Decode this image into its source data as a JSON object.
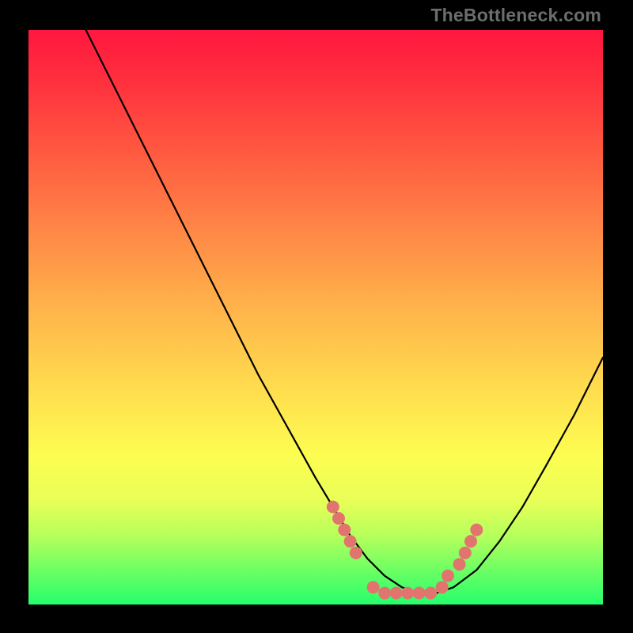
{
  "watermark": "TheBottleneck.com",
  "chart_data": {
    "type": "line",
    "title": "",
    "xlabel": "",
    "ylabel": "",
    "xlim": [
      0,
      100
    ],
    "ylim": [
      0,
      100
    ],
    "grid": false,
    "series": [
      {
        "name": "bottleneck-curve",
        "x": [
          10,
          15,
          20,
          25,
          30,
          35,
          40,
          45,
          50,
          53,
          56,
          59,
          62,
          65,
          68,
          71,
          74,
          78,
          82,
          86,
          90,
          95,
          100
        ],
        "y": [
          100,
          90,
          80,
          70,
          60,
          50,
          40,
          31,
          22,
          17,
          12,
          8,
          5,
          3,
          2,
          2,
          3,
          6,
          11,
          17,
          24,
          33,
          43
        ],
        "color": "#000000"
      }
    ],
    "markers": {
      "name": "highlight-dots",
      "color": "#e2746f",
      "points": [
        {
          "x": 53,
          "y": 17
        },
        {
          "x": 54,
          "y": 15
        },
        {
          "x": 55,
          "y": 13
        },
        {
          "x": 56,
          "y": 11
        },
        {
          "x": 57,
          "y": 9
        },
        {
          "x": 60,
          "y": 3
        },
        {
          "x": 62,
          "y": 2
        },
        {
          "x": 64,
          "y": 2
        },
        {
          "x": 66,
          "y": 2
        },
        {
          "x": 68,
          "y": 2
        },
        {
          "x": 70,
          "y": 2
        },
        {
          "x": 72,
          "y": 3
        },
        {
          "x": 73,
          "y": 5
        },
        {
          "x": 75,
          "y": 7
        },
        {
          "x": 76,
          "y": 9
        },
        {
          "x": 77,
          "y": 11
        },
        {
          "x": 78,
          "y": 13
        }
      ]
    }
  }
}
